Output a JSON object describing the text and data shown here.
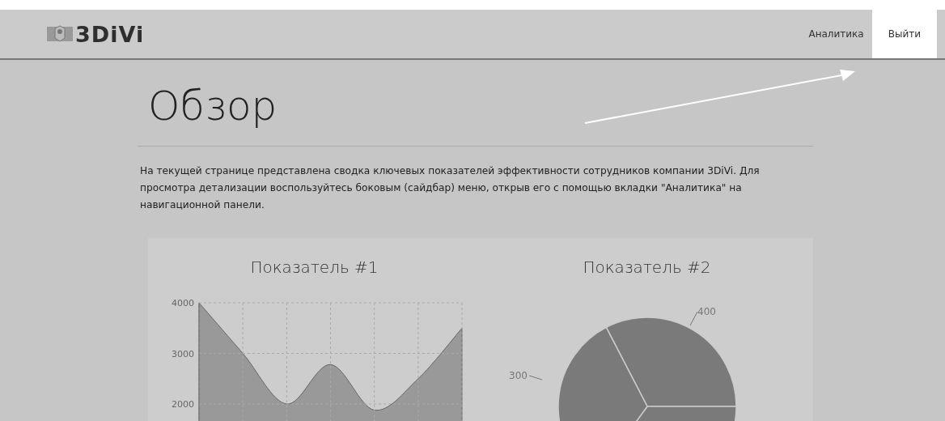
{
  "navbar": {
    "logo": "3DiVi",
    "links": [
      {
        "label": "Аналитика",
        "selected": false
      },
      {
        "label": "Выйти",
        "selected": true
      }
    ]
  },
  "page": {
    "title": "Обзор",
    "description": "На текущей странице представлена сводка ключевых показателей эффективности сотрудников компании 3DiVi. Для просмотра детализации воспользуйтесь боковым (сайдбар) меню, открыв его с помощью вкладки \"Аналитика\" на навигационной панели."
  },
  "charts": [
    {
      "title": "Показатель #1",
      "chart_data": {
        "type": "area",
        "values": [
          4000,
          3000,
          2000,
          2780,
          1880,
          2500,
          3500
        ],
        "yticks": [
          2000,
          3000,
          4000
        ],
        "ylim": [
          1600,
          4000
        ],
        "grid": true
      }
    },
    {
      "title": "Показатель #2",
      "pie_labels": [
        "400",
        "300"
      ]
    }
  ]
}
